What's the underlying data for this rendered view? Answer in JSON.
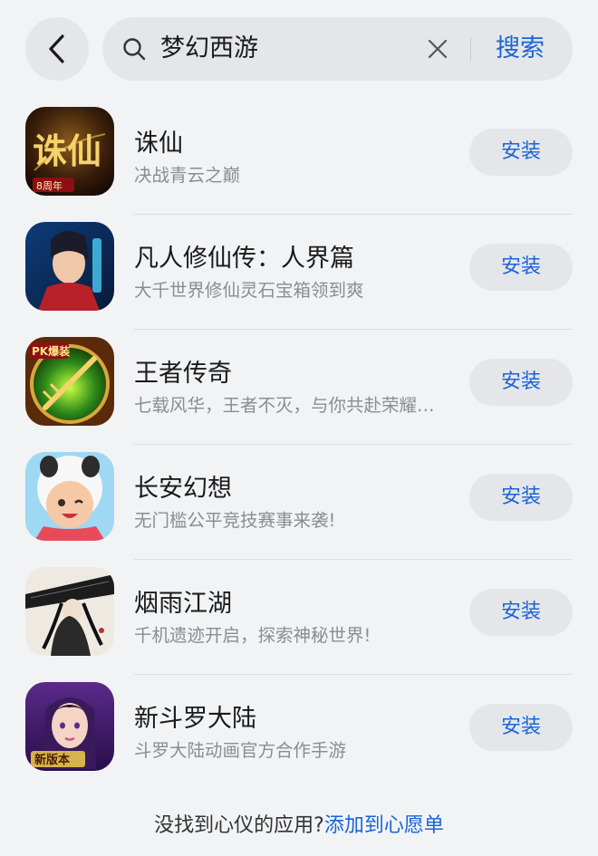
{
  "search": {
    "query": "梦幻西游",
    "submit_label": "搜索"
  },
  "apps": [
    {
      "name": "诛仙",
      "desc": "决战青云之巅",
      "button": "安装",
      "icon": "zhuxian-game-icon",
      "icon_text": "诛仙",
      "badge": "8周年"
    },
    {
      "name": "凡人修仙传：人界篇",
      "desc": "大千世界修仙灵石宝箱领到爽",
      "button": "安装",
      "icon": "fanren-game-icon"
    },
    {
      "name": "王者传奇",
      "desc": "七载风华，王者不灭，与你共赴荣耀征程",
      "button": "安装",
      "icon": "wangzhe-game-icon",
      "badge": "PK爆装"
    },
    {
      "name": "长安幻想",
      "desc": "无门槛公平竞技赛事来袭!",
      "button": "安装",
      "icon": "changan-game-icon"
    },
    {
      "name": "烟雨江湖",
      "desc": "千机遗迹开启，探索神秘世界!",
      "button": "安装",
      "icon": "yanyu-game-icon"
    },
    {
      "name": "新斗罗大陆",
      "desc": "斗罗大陆动画官方合作手游",
      "button": "安装",
      "icon": "douluo-game-icon",
      "badge": "新版本"
    }
  ],
  "footer": {
    "prompt": "没找到心仪的应用?",
    "link": "添加到心愿单"
  }
}
